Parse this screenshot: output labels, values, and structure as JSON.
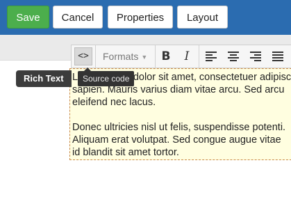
{
  "header": {
    "save_label": "Save",
    "cancel_label": "Cancel",
    "properties_label": "Properties",
    "layout_label": "Layout"
  },
  "toolbar": {
    "source_code_glyph": "<>",
    "formats_label": "Formats",
    "bold_glyph": "B",
    "italic_glyph": "I",
    "icons": [
      "source-code-icon",
      "bold-icon",
      "italic-icon",
      "align-left-icon",
      "align-center-icon",
      "align-right-icon",
      "align-justify-icon"
    ]
  },
  "tooltip": {
    "text": "Source code"
  },
  "field_label": "Rich Text",
  "editor": {
    "paragraph1": [
      "Lorem ipsum dolor sit amet, consectetuer adipiscing elit. Donec",
      "sapien. Mauris varius diam vitae arcu. Sed arcu",
      "eleifend nec lacus."
    ],
    "paragraph2": [
      "Donec ultricies nisl ut felis, suspendisse potenti.",
      "Aliquam erat volutpat. Sed congue augue vitae",
      "id blandit sit amet tortor."
    ]
  },
  "colors": {
    "header_bg": "#2b6cb0",
    "save_bg": "#4cae4c",
    "editor_bg": "#fffee0",
    "editor_border": "#c98a4a"
  }
}
